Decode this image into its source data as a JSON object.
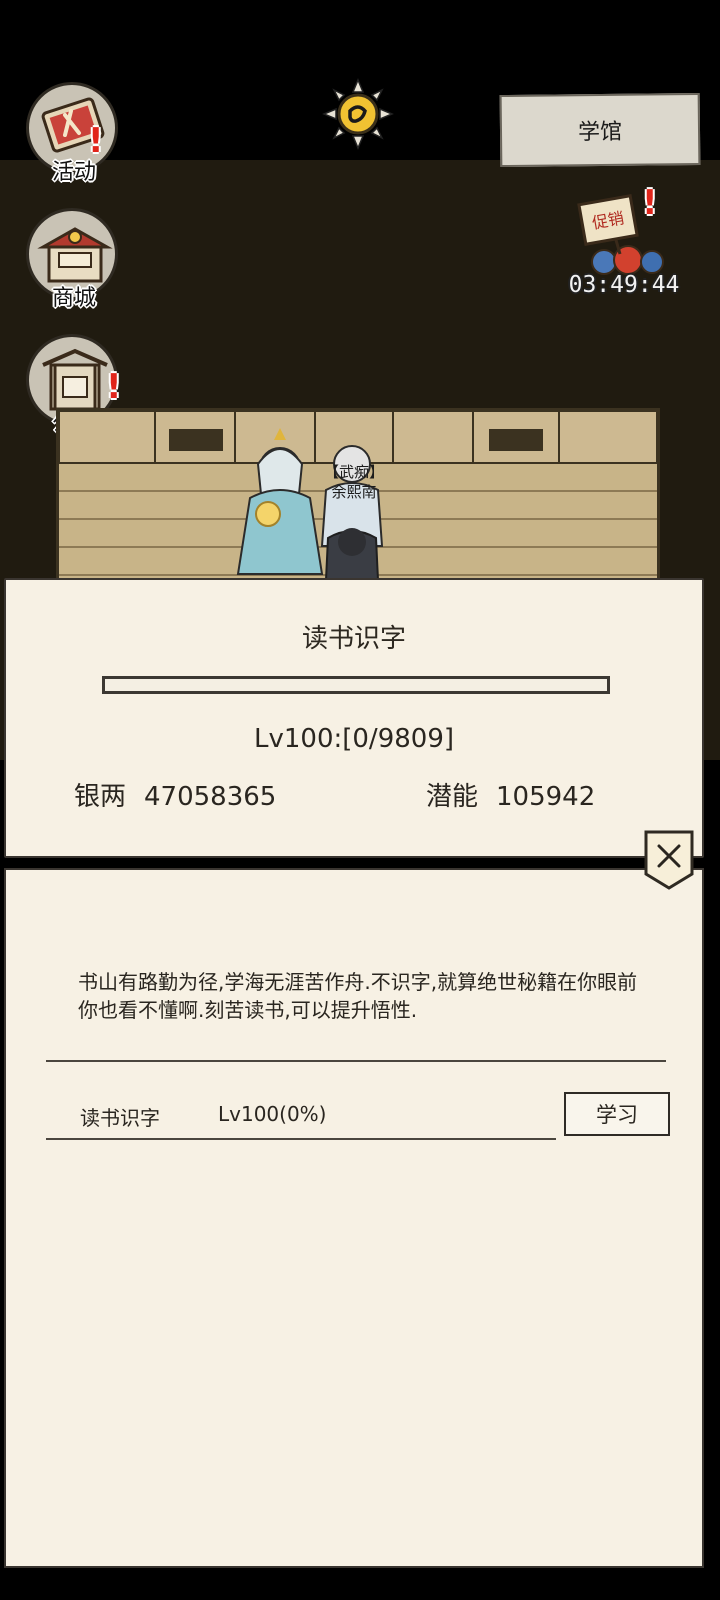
{
  "header": {
    "location_button_label": "学馆",
    "time_icon": "sun-with-ink-glyph-icon"
  },
  "side_menu": {
    "items": [
      {
        "label": "活动",
        "icon": "scroll-flag-icon",
        "alert": true
      },
      {
        "label": "商城",
        "icon": "shop-stall-icon",
        "alert": false
      },
      {
        "label": "公告",
        "icon": "notice-board-gate-icon",
        "alert": true
      }
    ]
  },
  "promo": {
    "sign_text": "促销",
    "timer": "03:49:44",
    "icon": "sale-sign-with-money-bags-icon"
  },
  "scene": {
    "npc_title": "【武痴】",
    "npc_name": "余熙南"
  },
  "study_panel": {
    "title": "读书识字",
    "progress_fraction": 0,
    "level_text": "Lv100:[0/9809]",
    "silver_label": "银两",
    "silver_value": "47058365",
    "potential_label": "潜能",
    "potential_value": "105942"
  },
  "detail_panel": {
    "description": "书山有路勤为径,学海无涯苦作舟.不识字,就算绝世秘籍在你眼前你也看不懂啊.刻苦读书,可以提升悟性.",
    "skill_name": "读书识字",
    "skill_level": "Lv100(0%)",
    "learn_button": "学习",
    "close_icon": "close-x-icon"
  },
  "colors": {
    "panel_bg": "#f7f1e4",
    "scene_bg": "#201b10",
    "alert_red": "#e1251b",
    "button_bg": "#dcd8cd"
  }
}
